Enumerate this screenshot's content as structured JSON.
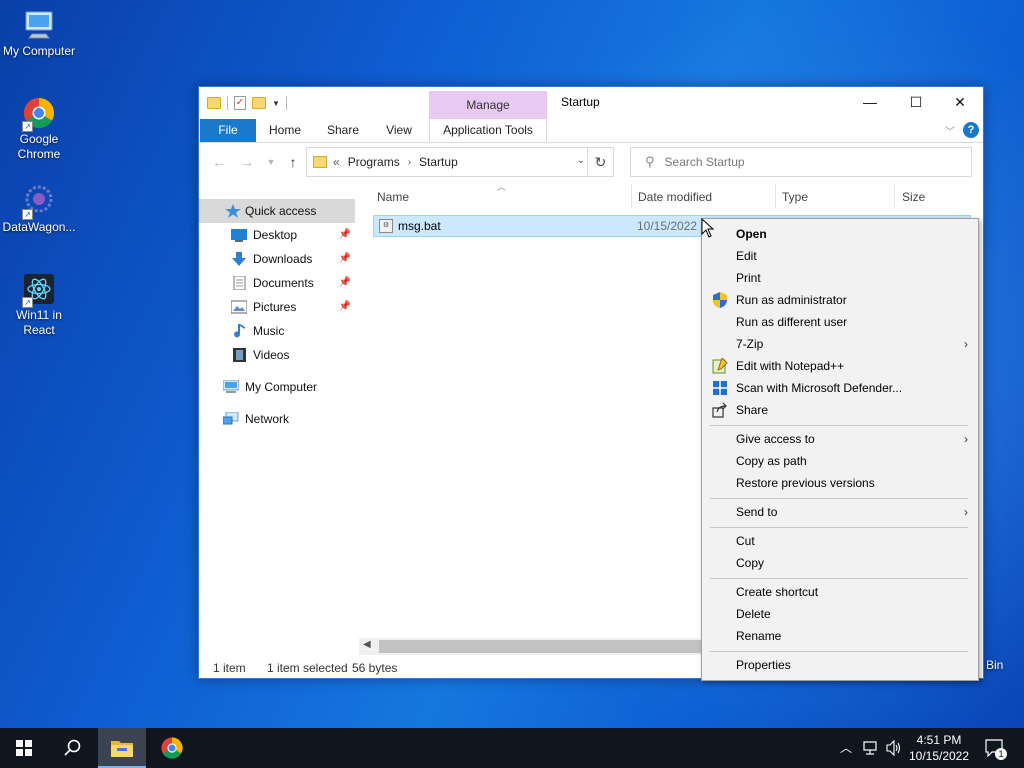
{
  "desktop": {
    "icons": [
      {
        "label": "My Computer",
        "icon": "computer-icon"
      },
      {
        "label": "Google Chrome",
        "icon": "chrome-icon"
      },
      {
        "label": "DataWagon...",
        "icon": "datawagon-icon"
      },
      {
        "label": "Win11 in React",
        "icon": "react-icon"
      }
    ],
    "recycle_bin_label": "Bin"
  },
  "window": {
    "title": "Startup",
    "contextual_tab_group": "Manage",
    "ribbon_tabs": [
      "File",
      "Home",
      "Share",
      "View",
      "Application Tools"
    ],
    "controls": {
      "minimize": "—",
      "maximize": "☐",
      "close": "✕"
    },
    "help": "?"
  },
  "address": {
    "overflow": "«",
    "crumbs": [
      "Programs",
      "Startup"
    ],
    "sep": "›"
  },
  "search": {
    "placeholder": "Search Startup"
  },
  "nav_pane": {
    "items": [
      {
        "label": "Quick access",
        "icon": "star-icon",
        "pinned": false
      },
      {
        "label": "Desktop",
        "icon": "desktop-icon",
        "pinned": true
      },
      {
        "label": "Downloads",
        "icon": "download-icon",
        "pinned": true
      },
      {
        "label": "Documents",
        "icon": "document-icon",
        "pinned": true
      },
      {
        "label": "Pictures",
        "icon": "pictures-icon",
        "pinned": true
      },
      {
        "label": "Music",
        "icon": "music-icon",
        "pinned": false
      },
      {
        "label": "Videos",
        "icon": "video-icon",
        "pinned": false
      },
      {
        "label": "My Computer",
        "icon": "computer-icon",
        "pinned": false
      },
      {
        "label": "Network",
        "icon": "network-icon",
        "pinned": false
      }
    ]
  },
  "file_list": {
    "columns": [
      "Name",
      "Date modified",
      "Type",
      "Size"
    ],
    "rows": [
      {
        "name": "msg.bat",
        "date": "10/15/2022"
      }
    ]
  },
  "status_bar": {
    "count": "1 item",
    "selection": "1 item selected",
    "size": "56 bytes"
  },
  "context_menu": {
    "items": [
      {
        "label": "Open",
        "bold": true
      },
      {
        "label": "Edit"
      },
      {
        "label": "Print"
      },
      {
        "label": "Run as administrator",
        "icon": "shield-icon"
      },
      {
        "label": "Run as different user"
      },
      {
        "label": "7-Zip",
        "submenu": true
      },
      {
        "label": "Edit with Notepad++",
        "icon": "notepad-plus-plus-icon"
      },
      {
        "label": "Scan with Microsoft Defender...",
        "icon": "defender-icon"
      },
      {
        "label": "Share",
        "icon": "share-icon"
      },
      {
        "label": "Give access to",
        "submenu": true
      },
      {
        "label": "Copy as path"
      },
      {
        "label": "Restore previous versions"
      },
      {
        "label": "Send to",
        "submenu": true
      },
      {
        "label": "Cut"
      },
      {
        "label": "Copy"
      },
      {
        "label": "Create shortcut"
      },
      {
        "label": "Delete"
      },
      {
        "label": "Rename"
      },
      {
        "label": "Properties"
      }
    ]
  },
  "taskbar": {
    "time": "4:51 PM",
    "date": "10/15/2022",
    "notification_count": "1"
  },
  "colors": {
    "accent": "#1979ca",
    "selection": "#cce8ff",
    "manage_tab": "#e7c9f2",
    "taskbar": "#10161e"
  }
}
